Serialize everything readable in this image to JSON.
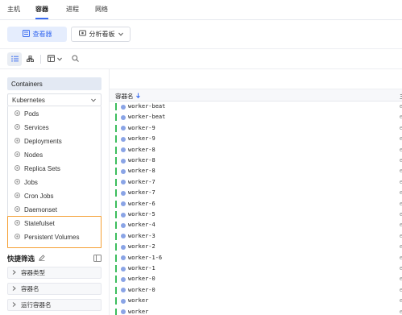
{
  "top_tabs": [
    "主机",
    "容器",
    "进程",
    "网络"
  ],
  "active_tab": "容器",
  "view_bar": {
    "view_button": "查看器",
    "dashboard_button": "分析看板"
  },
  "sidebar": {
    "header": "Containers",
    "group": "Kubernetes",
    "items": [
      "Pods",
      "Services",
      "Deployments",
      "Nodes",
      "Replica Sets",
      "Jobs",
      "Cron Jobs",
      "Daemonset",
      "Statefulset",
      "Persistent Volumes"
    ]
  },
  "quick_filter": {
    "title": "快捷筛选",
    "items": [
      "容器类型",
      "容器名",
      "运行容器名"
    ]
  },
  "table": {
    "column_name": "容器名",
    "next_column_initial": "主",
    "rows": [
      "worker-beat",
      "worker-beat",
      "worker-9",
      "worker-9",
      "worker-8",
      "worker-8",
      "worker-8",
      "worker-7",
      "worker-7",
      "worker-6",
      "worker-5",
      "worker-4",
      "worker-3",
      "worker-2",
      "worker-1-6",
      "worker-1",
      "worker-0",
      "worker-0",
      "worker",
      "worker"
    ],
    "row_extra": "e"
  },
  "colors": {
    "accent": "#3a6cf0",
    "status_green": "#3dbd5d",
    "highlight_orange": "#f5a034",
    "dot_blue": "#8aa4e6"
  },
  "icons": [
    "view-icon",
    "dashboard-icon",
    "chevron-down-icon",
    "list-icon",
    "tree-icon",
    "column-settings-icon",
    "search-icon",
    "edit-icon",
    "collapse-icon",
    "chevron-right-icon",
    "sort-icon",
    "item-bullet-icon"
  ]
}
